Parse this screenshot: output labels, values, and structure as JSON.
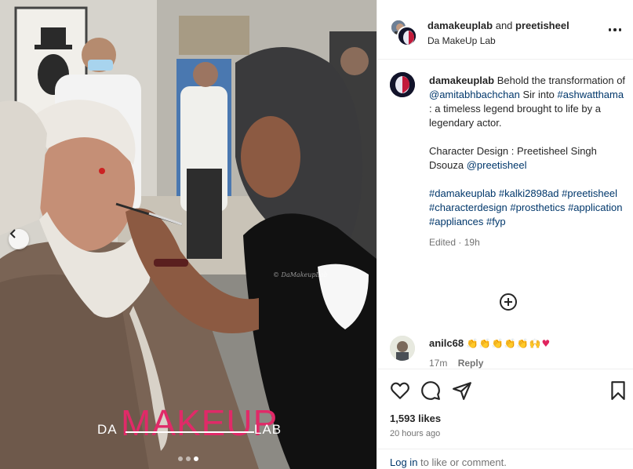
{
  "header": {
    "user1": "damakeuplab",
    "and": "and",
    "user2": "preetisheel",
    "subtitle": "Da MakeUp Lab"
  },
  "caption": {
    "username": "damakeuplab",
    "text_intro": "Behold the transformation of",
    "mention_1": "@amitabhbachchan",
    "text_2": "Sir into",
    "hashtag_1": "#ashwatthama",
    "text_3": ": a timeless legend brought to life by a legendary actor.",
    "credit_label": "Character Design : Preetisheel Singh Dsouza",
    "mention_2": "@preetisheel",
    "hashtags": [
      "#damakeuplab",
      "#kalki2898ad",
      "#preetisheel",
      "#characterdesign",
      "#prosthetics",
      "#application",
      "#appliances",
      "#fyp"
    ],
    "edited": "Edited",
    "time": "19h"
  },
  "comment": {
    "username": "anilc68",
    "time": "17m",
    "reply_label": "Reply"
  },
  "post": {
    "likes": "1,593 likes",
    "posted": "20 hours ago"
  },
  "login": {
    "link_label": "Log in",
    "suffix": "to like or comment."
  },
  "photo": {
    "watermark_da": "DA",
    "watermark_makeup": "MAKEUP",
    "watermark_lab": "LAB",
    "credit": "© DaMakeupLab",
    "carousel_total": 3,
    "carousel_active": 3
  },
  "icons": {
    "more": "more-options-icon",
    "add_comment": "add-comment-icon",
    "like": "heart-icon",
    "comment": "comment-icon",
    "share": "share-icon",
    "save": "bookmark-icon",
    "prev": "chevron-left-icon"
  },
  "colors": {
    "link": "#00376b",
    "muted": "#737373",
    "brand_pink": "#e02a68"
  }
}
